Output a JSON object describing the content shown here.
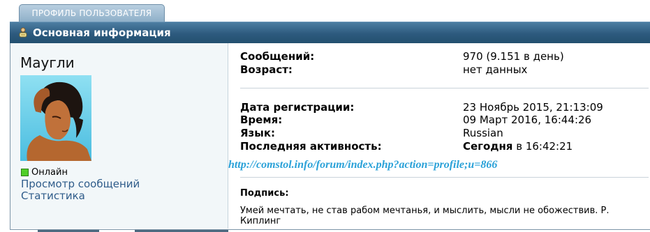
{
  "tab": {
    "label": "ПРОФИЛЬ ПОЛЬЗОВАТЕЛЯ"
  },
  "section": {
    "title": "Основная информация",
    "icon": "user-icon"
  },
  "user": {
    "name": "Маугли",
    "status": "Онлайн",
    "view_messages_link": "Просмотр сообщений",
    "stats_link": "Статистика"
  },
  "stats": {
    "messages_label": "Сообщений:",
    "messages_value": "970 (9.151 в день)",
    "age_label": "Возраст:",
    "age_value": "нет данных",
    "registered_label": "Дата регистрации:",
    "registered_value": "23 Ноябрь 2015, 21:13:09",
    "time_label": "Время:",
    "time_value": "09 Март 2016, 16:44:26",
    "language_label": "Язык:",
    "language_value": "Russian",
    "last_active_label": "Последняя активность:",
    "last_active_bold": "Сегодня",
    "last_active_rest": " в 16:42:21"
  },
  "watermark_url": "http://comstol.info/forum/index.php?action=profile;u=866",
  "signature": {
    "label": "Подпись:",
    "text": "Умей мечтать, не став рабом мечтанья, и мыслить, мысли не обожествив. Р. Киплинг"
  },
  "colors": {
    "header": "#2d5a7e",
    "tab": "#9fbcd3",
    "link": "#2f5c8a",
    "online": "#51cf28",
    "watermark": "#2aa1d8"
  }
}
